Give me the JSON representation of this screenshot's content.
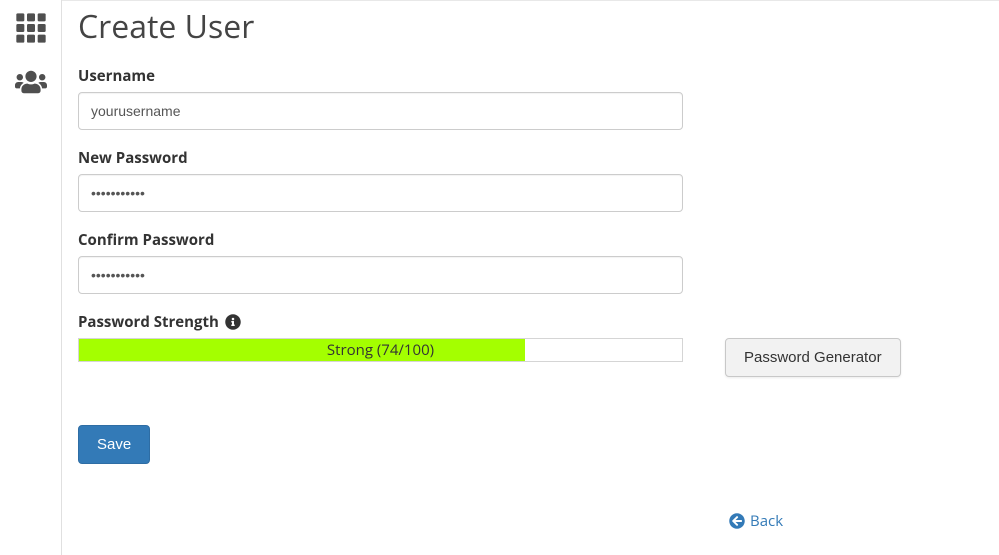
{
  "page": {
    "title": "Create User"
  },
  "form": {
    "username": {
      "label": "Username",
      "value": "yourusername"
    },
    "newPassword": {
      "label": "New Password",
      "value": "•••••••••••"
    },
    "confirmPassword": {
      "label": "Confirm Password",
      "value": "•••••••••••"
    },
    "passwordStrength": {
      "label": "Password Strength",
      "text": "Strong (74/100)",
      "percent": 74,
      "barColor": "#a4ff00"
    }
  },
  "buttons": {
    "save": "Save",
    "passwordGenerator": "Password Generator",
    "back": "Back"
  }
}
